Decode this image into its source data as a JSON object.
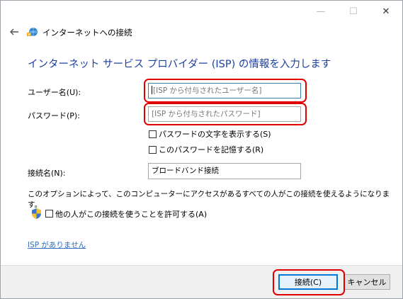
{
  "window": {
    "minimize_glyph": "—",
    "maximize_glyph": "☐",
    "close_glyph": "✕",
    "title": "インターネットへの接続"
  },
  "heading": "インターネット サービス プロバイダー (ISP) の情報を入力します",
  "form": {
    "username_label": "ユーザー名(U):",
    "username_placeholder": "[ISP から付与されたユーザー名]",
    "password_label": "パスワード(P):",
    "password_placeholder": "[ISP から付与されたパスワード]",
    "show_password_label": "パスワードの文字を表示する(S)",
    "remember_password_label": "このパスワードを記憶する(R)",
    "connection_name_label": "接続名(N):",
    "connection_name_value": "ブロードバンド接続"
  },
  "note": "このオプションによって、このコンピューターにアクセスがあるすべての人がこの接続を使えるようになります。",
  "allow_others_label": "他の人がこの接続を使うことを許可する(A)",
  "no_isp_link": "ISP がありません",
  "buttons": {
    "connect": "接続(C)",
    "cancel": "キャンセル"
  },
  "colors": {
    "heading": "#1d3fa0",
    "link": "#2e6fc0",
    "highlight_ring": "#e00000",
    "default_button_border": "#0078d7"
  },
  "icons": {
    "back": "back-arrow-icon",
    "app": "network-globe-icon",
    "shield": "uac-shield-icon"
  }
}
